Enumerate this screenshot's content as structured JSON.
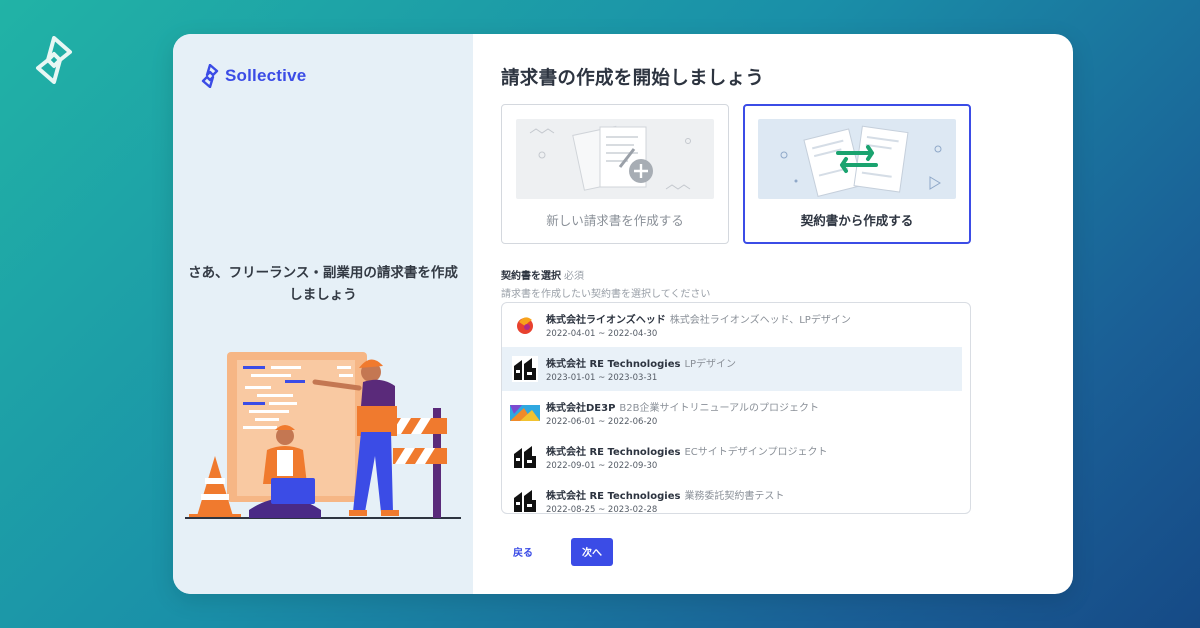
{
  "brand": {
    "name": "Sollective"
  },
  "left": {
    "tagline": "さあ、フリーランス・副業用の請求書を作成しましょう"
  },
  "main": {
    "title": "請求書の作成を開始しましょう",
    "options": [
      {
        "label": "新しい請求書を作成する",
        "selected": false
      },
      {
        "label": "契約書から作成する",
        "selected": true
      }
    ],
    "select_label": "契約書を選択",
    "required": "必須",
    "select_hint": "請求書を作成したい契約書を選択してください",
    "contracts": [
      {
        "company": "株式会社ライオンズヘッド",
        "project": "株式会社ライオンズヘッド、LPデザイン",
        "period": "2022-04-01 ~ 2022-04-30",
        "icon": "lionshead-logo-icon",
        "selected": false
      },
      {
        "company": "株式会社 RE Technologies",
        "project": "LPデザイン",
        "period": "2023-01-01 ~ 2023-03-31",
        "icon": "re-technologies-logo-icon",
        "selected": true
      },
      {
        "company": "株式会社DE3P",
        "project": "B2B企業サイトリニューアルのプロジェクト",
        "period": "2022-06-01 ~ 2022-06-20",
        "icon": "de3p-logo-icon",
        "selected": false
      },
      {
        "company": "株式会社 RE Technologies",
        "project": "ECサイトデザインプロジェクト",
        "period": "2022-09-01 ~ 2022-09-30",
        "icon": "re-technologies-logo-icon",
        "selected": false
      },
      {
        "company": "株式会社 RE Technologies",
        "project": "業務委託契約書テスト",
        "period": "2022-08-25 ~ 2023-02-28",
        "icon": "re-technologies-logo-icon",
        "selected": false
      }
    ],
    "back_label": "戻る",
    "next_label": "次へ"
  },
  "colors": {
    "accent": "#3b4ce6",
    "green": "#1aa36f",
    "selected_row": "#e9f1f8"
  }
}
